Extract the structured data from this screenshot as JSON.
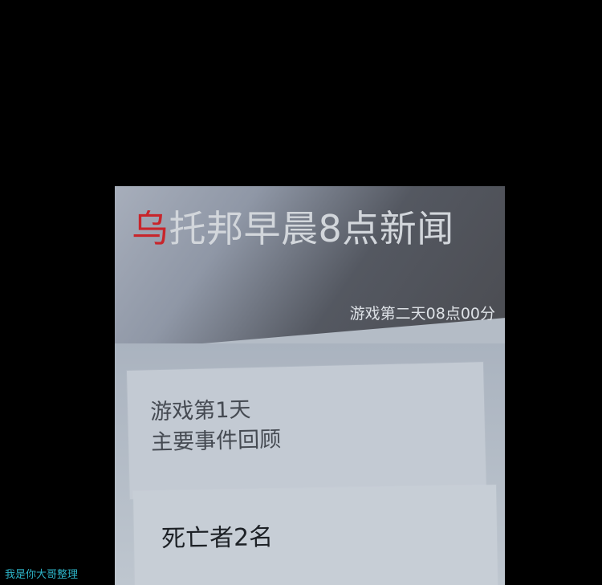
{
  "news": {
    "title_highlight": "乌",
    "title_rest": "托邦早晨8点新闻",
    "timestamp": "游戏第二天08点00分"
  },
  "summary": {
    "line1": "游戏第1天",
    "line2": "主要事件回顾"
  },
  "deaths": {
    "text": "死亡者2名"
  },
  "watermark": "我是你大哥整理",
  "colors": {
    "background": "#000000",
    "title_highlight": "#c8252b",
    "title_text": "#d2d6db",
    "watermark": "#2db4c8"
  }
}
